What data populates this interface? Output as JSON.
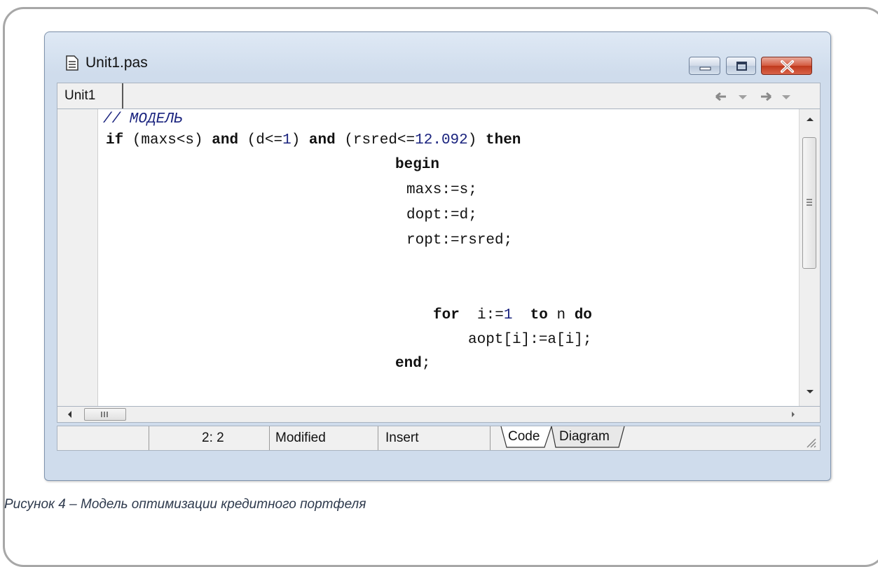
{
  "window": {
    "title": "Unit1.pas"
  },
  "tabs": [
    {
      "label": "Unit1"
    }
  ],
  "editor": {
    "lines": [
      {
        "segments": [
          {
            "t": "// МОДЕЛЬ",
            "c": "cm"
          }
        ]
      },
      {
        "segments": [
          {
            "t": "if",
            "c": "kw"
          },
          {
            "t": " (maxs<s) ",
            "c": ""
          },
          {
            "t": "and",
            "c": "kw"
          },
          {
            "t": " (d<=",
            "c": ""
          },
          {
            "t": "1",
            "c": "num"
          },
          {
            "t": ") ",
            "c": ""
          },
          {
            "t": "and",
            "c": "kw"
          },
          {
            "t": " (rsred<=",
            "c": ""
          },
          {
            "t": "12.092",
            "c": "num"
          },
          {
            "t": ") ",
            "c": ""
          },
          {
            "t": "then",
            "c": "kw"
          }
        ]
      },
      {
        "segments": [
          {
            "t": "begin",
            "c": "kw"
          }
        ]
      },
      {
        "segments": [
          {
            "t": "maxs:=s;",
            "c": ""
          }
        ]
      },
      {
        "segments": [
          {
            "t": "dopt:=d;",
            "c": ""
          }
        ]
      },
      {
        "segments": [
          {
            "t": "ropt:=rsred;",
            "c": ""
          }
        ]
      },
      {
        "segments": [
          {
            "t": "for",
            "c": "kw"
          },
          {
            "t": "  i:=",
            "c": ""
          },
          {
            "t": "1",
            "c": "num"
          },
          {
            "t": "  ",
            "c": ""
          },
          {
            "t": "to",
            "c": "kw"
          },
          {
            "t": " n ",
            "c": ""
          },
          {
            "t": "do",
            "c": "kw"
          }
        ]
      },
      {
        "segments": [
          {
            "t": "aopt[i]:=a[i];",
            "c": ""
          }
        ]
      },
      {
        "segments": [
          {
            "t": "end",
            "c": "kw"
          },
          {
            "t": ";",
            "c": ""
          }
        ]
      }
    ]
  },
  "statusbar": {
    "position": "2:  2",
    "modified": "Modified",
    "mode": "Insert",
    "tab_code": "Code",
    "tab_diagram": "Diagram"
  },
  "caption": "Рисунок 4  – Модель оптимизации кредитного портфеля",
  "icons": {
    "file": "file-icon",
    "minimize": "minimize-icon",
    "maximize": "maximize-icon",
    "close": "close-icon",
    "back": "arrow-left-icon",
    "forward": "arrow-right-icon"
  },
  "colors": {
    "close_button": "#c0391c",
    "keyword": "#111111",
    "number": "#1a237e",
    "comment": "#1a237e"
  }
}
